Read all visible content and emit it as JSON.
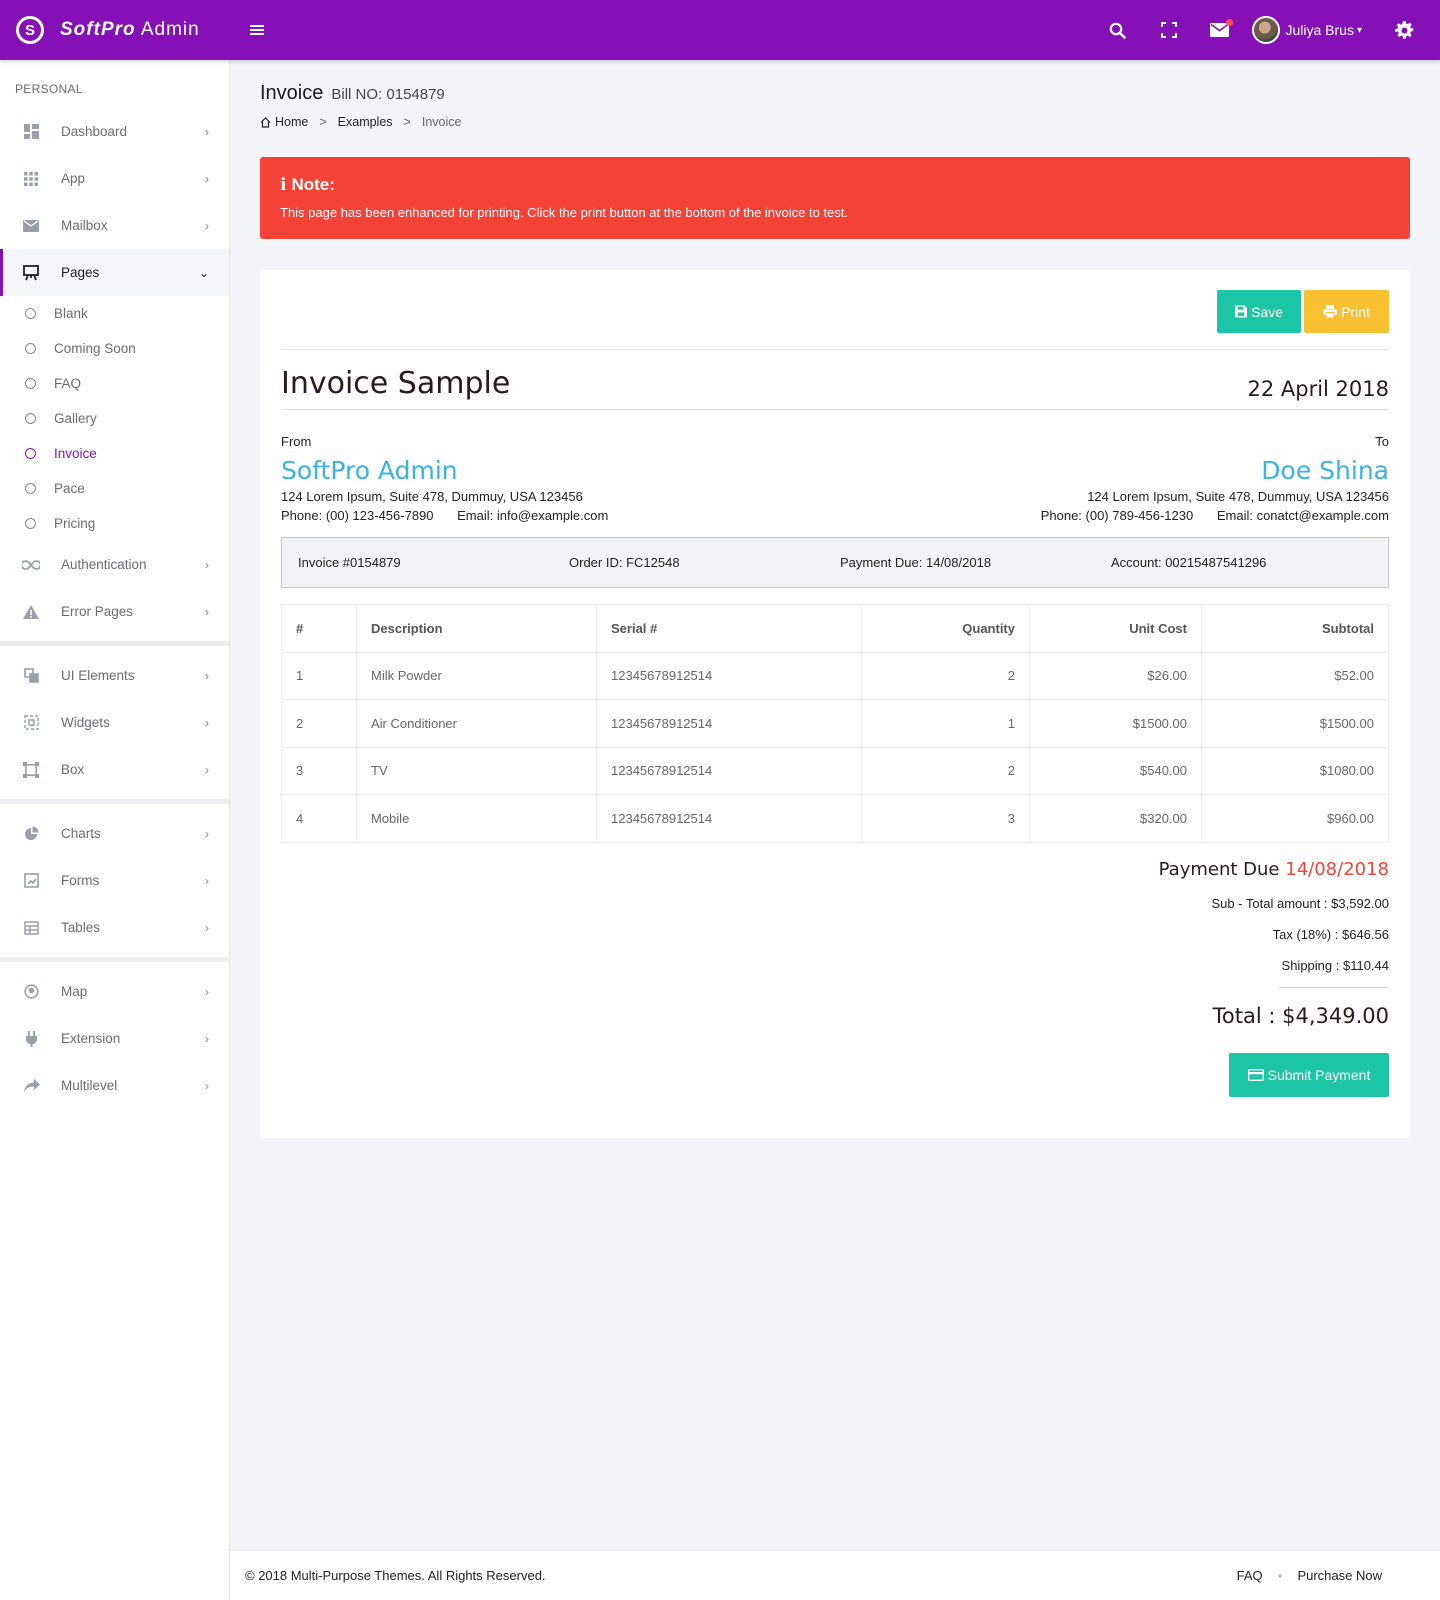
{
  "brand": {
    "logo_letter": "S",
    "name_bold": "Soft",
    "name_italic": "Pro",
    "name_rest": "Admin"
  },
  "header": {
    "user_name": "Juliya Brus",
    "icons": [
      "menu-icon",
      "search-icon",
      "fullscreen-icon",
      "mail-icon",
      "settings-icon"
    ]
  },
  "sidebar": {
    "section_label": "PERSONAL",
    "items_top": [
      {
        "label": "Dashboard",
        "icon": "dashboard-icon"
      },
      {
        "label": "App",
        "icon": "apps-grid-icon"
      },
      {
        "label": "Mailbox",
        "icon": "mail-icon"
      }
    ],
    "pages": {
      "label": "Pages",
      "sub": [
        "Blank",
        "Coming Soon",
        "FAQ",
        "Gallery",
        "Invoice",
        "Pace",
        "Pricing"
      ],
      "current": "Invoice"
    },
    "items_after_pages": [
      {
        "label": "Authentication",
        "icon": "infinity-icon"
      },
      {
        "label": "Error Pages",
        "icon": "warning-icon"
      }
    ],
    "group2": [
      {
        "label": "UI Elements",
        "icon": "layers-icon"
      },
      {
        "label": "Widgets",
        "icon": "widgets-icon"
      },
      {
        "label": "Box",
        "icon": "box-icon"
      }
    ],
    "group3": [
      {
        "label": "Charts",
        "icon": "pie-chart-icon"
      },
      {
        "label": "Forms",
        "icon": "forms-icon"
      },
      {
        "label": "Tables",
        "icon": "table-icon"
      }
    ],
    "group4": [
      {
        "label": "Map",
        "icon": "map-pin-icon"
      },
      {
        "label": "Extension",
        "icon": "plug-icon"
      },
      {
        "label": "Multilevel",
        "icon": "share-icon"
      }
    ]
  },
  "page": {
    "title": "Invoice",
    "subtitle": "Bill NO: 0154879",
    "breadcrumb": [
      "Home",
      "Examples",
      "Invoice"
    ],
    "breadcrumb_sep": ">"
  },
  "note": {
    "title": "Note:",
    "text": "This page has been enhanced for printing. Click the print button at the bottom of the invoice to test."
  },
  "invoice": {
    "save_label": "Save",
    "print_label": "Print",
    "title": "Invoice Sample",
    "date": "22 April 2018",
    "from": {
      "label": "From",
      "name": "SoftPro Admin",
      "address": "124 Lorem Ipsum, Suite 478, Dummuy, USA 123456",
      "phone": "Phone: (00) 123-456-7890",
      "email": "Email: info@example.com"
    },
    "to": {
      "label": "To",
      "name": "Doe Shina",
      "address": "124 Lorem Ipsum, Suite 478, Dummuy, USA 123456",
      "phone": "Phone: (00) 789-456-1230",
      "email": "Email: conatct@example.com"
    },
    "info": {
      "invoice_no": "Invoice #0154879",
      "order_id": "Order ID: FC12548",
      "payment_due": "Payment Due: 14/08/2018",
      "account": "Account: 00215487541296"
    },
    "table": {
      "headers": [
        "#",
        "Description",
        "Serial #",
        "Quantity",
        "Unit Cost",
        "Subtotal"
      ],
      "rows": [
        [
          "1",
          "Milk Powder",
          "12345678912514",
          "2",
          "$26.00",
          "$52.00"
        ],
        [
          "2",
          "Air Conditioner",
          "12345678912514",
          "1",
          "$1500.00",
          "$1500.00"
        ],
        [
          "3",
          "TV",
          "12345678912514",
          "2",
          "$540.00",
          "$1080.00"
        ],
        [
          "4",
          "Mobile",
          "12345678912514",
          "3",
          "$320.00",
          "$960.00"
        ]
      ]
    },
    "totals": {
      "payment_due_label": "Payment Due",
      "payment_due_date": "14/08/2018",
      "subtotal": "Sub - Total amount : $3,592.00",
      "tax": "Tax (18%) : $646.56",
      "shipping": "Shipping : $110.44",
      "total": "Total : $4,349.00"
    },
    "submit_label": "Submit Payment"
  },
  "footer": {
    "copyright": "© 2018 Multi-Purpose Themes. All Rights Reserved.",
    "links": [
      "FAQ",
      "Purchase Now"
    ]
  },
  "colors": {
    "primary": "#8511b6",
    "danger": "#f44237",
    "success": "#1bc5a6",
    "warning": "#f9c131",
    "info": "#39b3e0"
  }
}
